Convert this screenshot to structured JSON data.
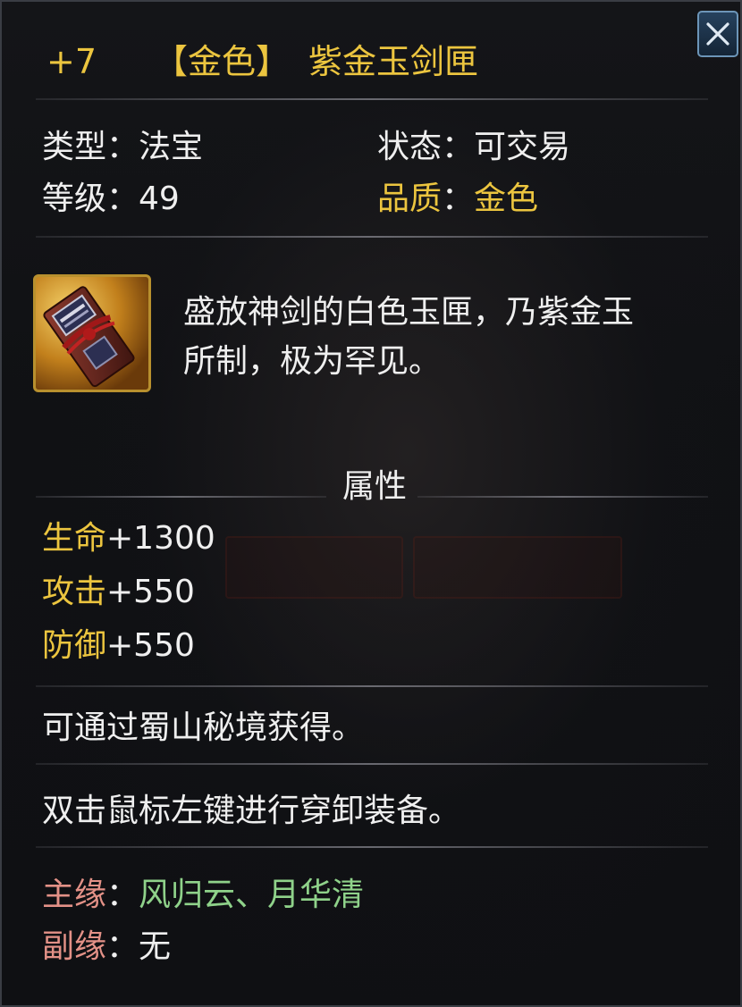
{
  "header": {
    "enhance_level": "+7",
    "quality_bracket": "【金色】",
    "item_name": "紫金玉剑匣"
  },
  "stats_info": {
    "type_label": "类型",
    "type_value": "法宝",
    "status_label": "状态",
    "status_value": "可交易",
    "level_label": "等级",
    "level_value": "49",
    "quality_label": "品质",
    "quality_value": "金色",
    "colon": "："
  },
  "description": {
    "line1": "盛放神剑的白色玉匣，乃紫金玉",
    "line2": "所制，极为罕见。"
  },
  "attributes": {
    "title": "属性",
    "items": [
      {
        "name": "生命",
        "value": "+1300"
      },
      {
        "name": "攻击",
        "value": "+550"
      },
      {
        "name": "防御",
        "value": "+550"
      }
    ]
  },
  "source_text": "可通过蜀山秘境获得。",
  "usage_text": "双击鼠标左键进行穿卸装备。",
  "fate": {
    "main_label": "主缘",
    "main_value": "风归云、月华清",
    "sub_label": "副缘",
    "sub_value": "无"
  },
  "colors": {
    "gold": "#ecc53f",
    "green": "#8fd28a",
    "rose": "#e39187",
    "white": "#efefef"
  }
}
